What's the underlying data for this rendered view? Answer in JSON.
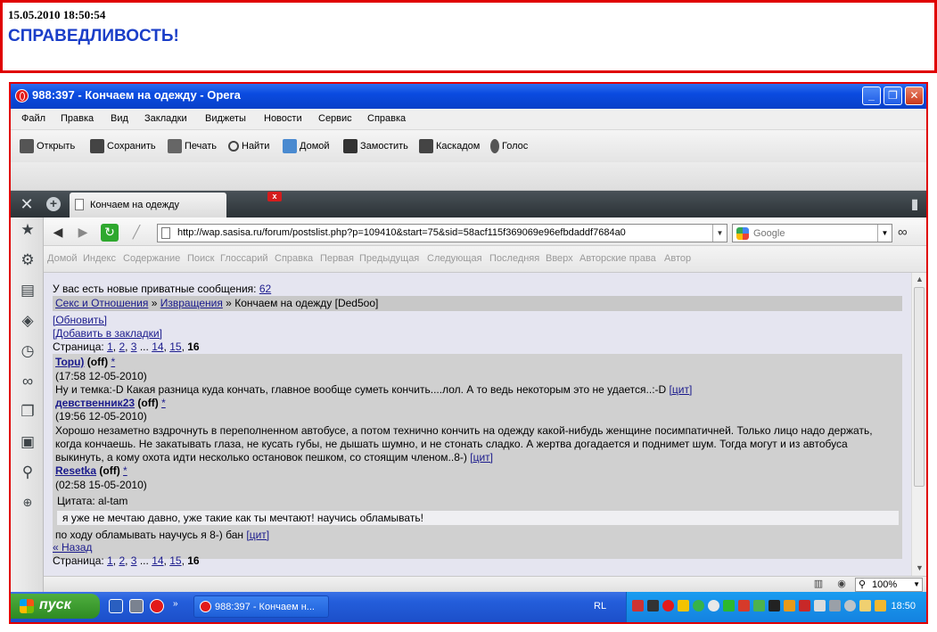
{
  "post": {
    "date": "15.05.2010 18:50:54",
    "title": "СПРАВЕДЛИВОСТЬ!"
  },
  "window": {
    "title": "988:397 - Кончаем на одежду - Opera",
    "minimize": "_",
    "maximize": "❐",
    "close": "✕"
  },
  "menu": [
    "Файл",
    "Правка",
    "Вид",
    "Закладки",
    "Виджеты",
    "Новости",
    "Сервис",
    "Справка"
  ],
  "toolbar": [
    "Открыть",
    "Сохранить",
    "Печать",
    "Найти",
    "Домой",
    "Замостить",
    "Каскадом",
    "Голос"
  ],
  "tab": {
    "label": "Кончаем на одежду"
  },
  "address": {
    "url": "http://wap.sasisa.ru/forum/postslist.php?p=109410&start=75&sid=58acf115f369069e96efbdaddf7684a0",
    "search_placeholder": "Google"
  },
  "navlinks": [
    "Домой",
    "Индекс",
    "Содержание",
    "Поиск",
    "Глоссарий",
    "Справка",
    "Первая",
    "Предыдущая",
    "Следующая",
    "Последняя",
    "Вверх",
    "Авторские права",
    "Автор"
  ],
  "page": {
    "private_msg": "У вас есть новые приватные сообщения:",
    "private_count": "62",
    "breadcrumb_1": "Секс и Отношения",
    "breadcrumb_sep": "»",
    "breadcrumb_2": "Извращения",
    "breadcrumb_3": "Кончаем на одежду [Ded5oo]",
    "refresh": "[Обновить]",
    "bookmark": "[Добавить в закладки]",
    "pages_label": "Страница:",
    "pages": [
      "1",
      "2",
      "3",
      "...",
      "14",
      "15",
      "16"
    ],
    "back": "« Назад"
  },
  "posts": [
    {
      "author": "Topu)",
      "status": "(off)",
      "star": "*",
      "time": "(17:58 12-05-2010)",
      "text": "Ну и темка:-D Какая разница куда кончать, главное вообще суметь кончить....лол. А то ведь некоторым это не удается..:-D",
      "cite": "[цит]"
    },
    {
      "author": "девственник23",
      "status": "(off)",
      "star": "*",
      "time": "(19:56 12-05-2010)",
      "text_1": "Хорошо незаметно вздрочнуть в переполненном автобусе, а потом технично кончить на одежду какой-нибудь женщине посимпатичней. Только лицо надо держать,",
      "text_2": "когда кончаешь. Не закатывать глаза, не кусать губы, не дышать шумно, и не стонать сладко. А жертва догадается и поднимет шум. Тогда могут и из автобуса",
      "text_3": "выкинуть, а кому охота идти несколько остановок пешком, со стоящим членом..8-)",
      "cite": "[цит]"
    },
    {
      "author": "Resetka",
      "status": "(off)",
      "star": "*",
      "time": "(02:58 15-05-2010)",
      "quote_label": "Цитата: al-tam",
      "quote_text": "я уже не мечтаю давно, уже такие как ты мечтают! научись обламывать!",
      "text": "по ходу обламывать научусь я 8-) бан",
      "cite": "[цит]"
    }
  ],
  "status": {
    "zoom": "100%"
  },
  "taskbar": {
    "start": "пуск",
    "task": "988:397 - Кончаем н...",
    "lang": "RL",
    "clock": "18:50"
  },
  "icons": {
    "tools": "tools-icon",
    "new_tab": "plus-icon",
    "trash": "trash-icon",
    "back": "back-arrow-icon",
    "forward": "forward-arrow-icon",
    "reload": "reload-icon",
    "edit": "wand-icon",
    "reading": "glasses-icon"
  }
}
